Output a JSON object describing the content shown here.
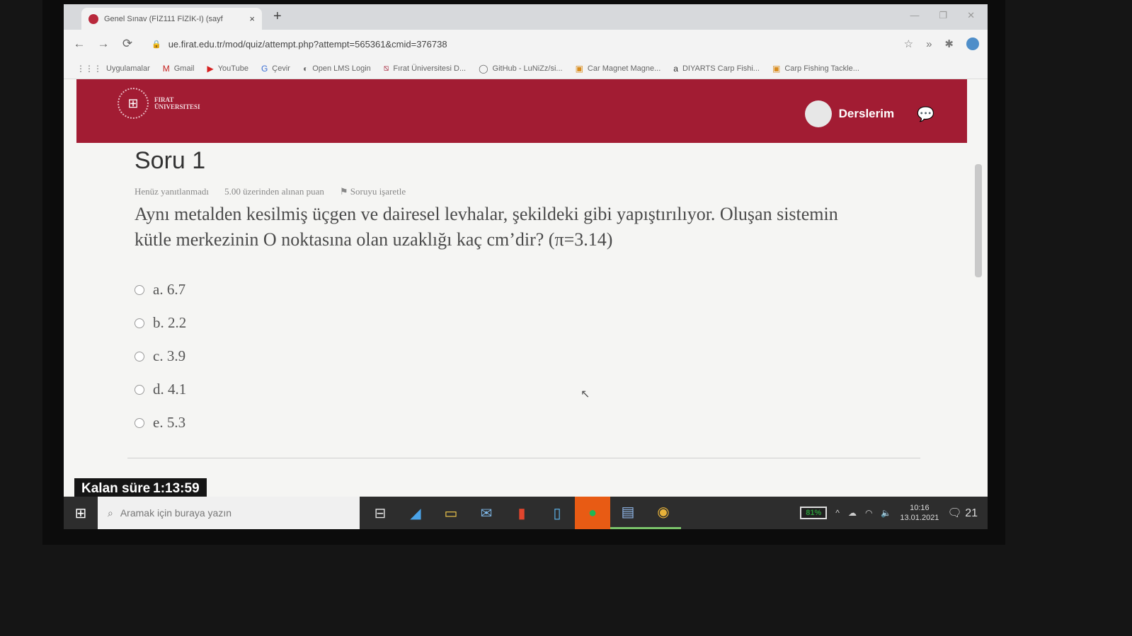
{
  "browser": {
    "tab_title": "Genel Sınav (FİZ111 FİZİK-I) (sayf",
    "tab_close": "×",
    "new_tab": "+",
    "window_controls": [
      "—",
      "❐",
      "✕"
    ],
    "back": "←",
    "forward": "→",
    "reload": "⟳",
    "url": "ue.firat.edu.tr/mod/quiz/attempt.php?attempt=565361&cmid=376738",
    "star_icon": "☆",
    "ext_icons": [
      "»",
      "✱"
    ]
  },
  "bookmarks": [
    {
      "icon": "⋮⋮⋮",
      "label": "Uygulamalar"
    },
    {
      "icon": "M",
      "label": "Gmail"
    },
    {
      "icon": "▶",
      "label": "YouTube"
    },
    {
      "icon": "G",
      "label": "Çevir"
    },
    {
      "icon": "◐",
      "label": "Open LMS Login"
    },
    {
      "icon": "⧅",
      "label": "Fırat Üniversitesi D..."
    },
    {
      "icon": "◯",
      "label": "GitHub - LuNiZz/si..."
    },
    {
      "icon": "▣",
      "label": "Car Magnet Magne..."
    },
    {
      "icon": "a",
      "label": "DIYARTS Carp Fishi..."
    },
    {
      "icon": "▣",
      "label": "Carp Fishing Tackle..."
    }
  ],
  "site": {
    "logo_line1": "FIRAT",
    "logo_line2": "ÜNIVERSITESI",
    "logo_symbol": "⊞",
    "nav_label": "Derslerim",
    "chat_icon": "💬"
  },
  "question": {
    "title": "Soru 1",
    "status": "Henüz yanıtlanmadı",
    "points": "5.00 üzerinden alınan puan",
    "flag": "Soruyu işaretle",
    "text_line1": "Aynı metalden kesilmiş üçgen ve dairesel levhalar, şekildeki gibi yapıştırılıyor. Oluşan sistemin",
    "text_line2": "kütle merkezinin O noktasına olan uzaklığı kaç cm’dir? (π=3.14)",
    "answers": [
      "a. 6.7",
      "b. 2.2",
      "c. 3.9",
      "d. 4.1",
      "e. 5.3"
    ]
  },
  "timer": {
    "label": "Kalan süre",
    "value": "1:13:59"
  },
  "taskbar": {
    "start_icon": "⊞",
    "search_placeholder": "Aramak için buraya yazın",
    "search_icon": "⌕",
    "apps": [
      "⊟",
      "◢",
      "▭",
      "✉",
      "▮",
      "▯",
      "●",
      "▤",
      "◉"
    ],
    "battery": "81%",
    "time": "10:16",
    "date": "13.01.2021",
    "notifications": "21"
  }
}
